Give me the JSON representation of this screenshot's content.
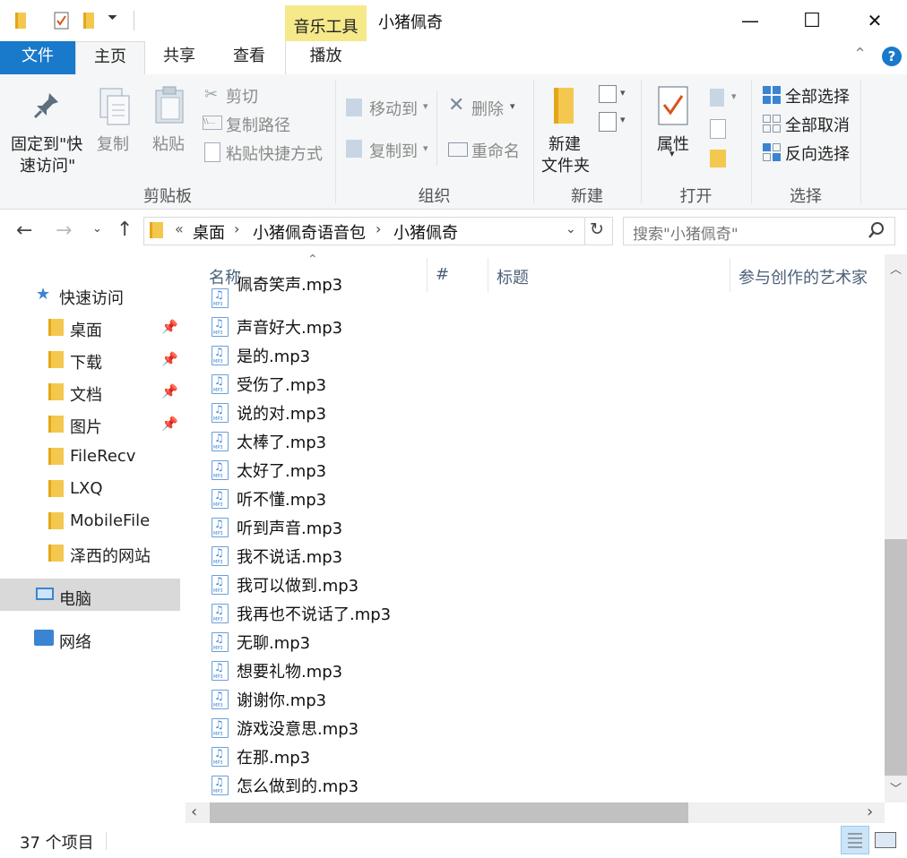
{
  "title_bar": {
    "context_tab": "音乐工具",
    "window_title": "小猪佩奇",
    "minimize": "—",
    "maximize": "☐",
    "close": "✕"
  },
  "tabs": {
    "file": "文件",
    "home": "主页",
    "share": "共享",
    "view": "查看",
    "play": "播放"
  },
  "ribbon": {
    "clipboard": {
      "pin": "固定到\"快",
      "pin2": "速访问\"",
      "copy": "复制",
      "paste": "粘贴",
      "cut": "剪切",
      "copy_path": "复制路径",
      "paste_shortcut": "粘贴快捷方式",
      "label": "剪贴板"
    },
    "organize": {
      "move_to": "移动到",
      "copy_to": "复制到",
      "delete": "删除",
      "rename": "重命名",
      "label": "组织"
    },
    "new": {
      "new_folder": "新建",
      "new_folder2": "文件夹",
      "label": "新建"
    },
    "open": {
      "properties": "属性",
      "label": "打开"
    },
    "select": {
      "select_all": "全部选择",
      "select_none": "全部取消",
      "invert": "反向选择",
      "label": "选择"
    }
  },
  "address": {
    "sep": "«",
    "crumbs": [
      "桌面",
      "小猪佩奇语音包",
      "小猪佩奇"
    ],
    "search_placeholder": "搜索\"小猪佩奇\""
  },
  "sidebar": {
    "quick_access": "快速访问",
    "items": [
      "桌面",
      "下载",
      "文档",
      "图片",
      "FileRecv",
      "LXQ",
      "MobileFile",
      "泽西的网站"
    ],
    "this_pc": "电脑",
    "network": "网络"
  },
  "columns": {
    "name": "名称",
    "number": "#",
    "title": "标题",
    "artist": "参与创作的艺术家"
  },
  "files": [
    "佩奇笑声.mp3",
    "声音好大.mp3",
    "是的.mp3",
    "受伤了.mp3",
    "说的对.mp3",
    "太棒了.mp3",
    "太好了.mp3",
    "听不懂.mp3",
    "听到声音.mp3",
    "我不说话.mp3",
    "我可以做到.mp3",
    "我再也不说话了.mp3",
    "无聊.mp3",
    "想要礼物.mp3",
    "谢谢你.mp3",
    "游戏没意思.mp3",
    "在那.mp3",
    "怎么做到的.mp3"
  ],
  "status": {
    "count": "37 个项目"
  },
  "colors": {
    "file_tab": "#1979ca",
    "context_tab": "#f6e98a",
    "ribbon_bg": "#f5f6f7",
    "selected_nav": "#d9d9d9"
  }
}
